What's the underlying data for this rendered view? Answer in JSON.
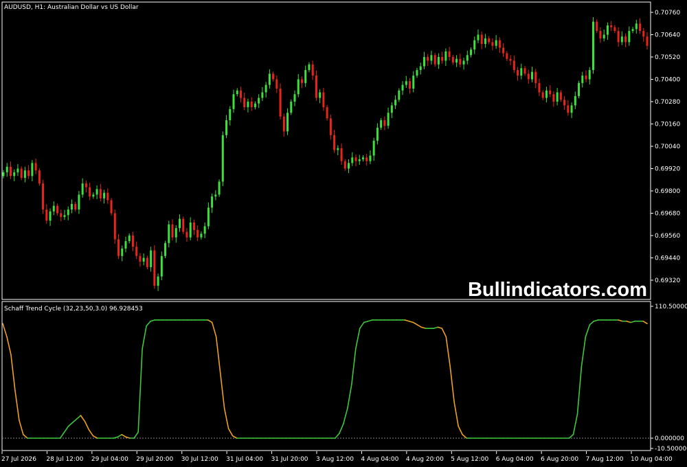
{
  "main_chart": {
    "symbol_label": "AUDUSD, H1:  Australian Dollar vs US Dollar",
    "price_ticks": [
      "0.70760",
      "0.70640",
      "0.70520",
      "0.70400",
      "0.70280",
      "0.70160",
      "0.70040",
      "0.69920",
      "0.69800",
      "0.69680",
      "0.69560",
      "0.69440",
      "0.69320"
    ],
    "watermark": "Bullindicators.com",
    "colors": {
      "bull": "#3ee03e",
      "bear": "#e8251b",
      "background": "#000000",
      "frame": "#ffffff"
    }
  },
  "indicator": {
    "label": "Schaff Trend Cycle (32,23,50,3.0) 96.928453",
    "max_label": "110.500000",
    "zero_label": "0.000000",
    "min_label": "-10.500000",
    "colors": {
      "rising": "#3ec83e",
      "falling": "#f0a020"
    }
  },
  "time_axis": {
    "labels": [
      "27 Jul 2026",
      "28 Jul 12:00",
      "29 Jul 04:00",
      "29 Jul 20:00",
      "30 Jul 12:00",
      "31 Jul 04:00",
      "31 Jul 20:00",
      "3 Aug 12:00",
      "4 Aug 04:00",
      "4 Aug 20:00",
      "5 Aug 12:00",
      "6 Aug 04:00",
      "6 Aug 20:00",
      "7 Aug 12:00",
      "10 Aug 04:00"
    ]
  },
  "chart_data": [
    {
      "type": "candlestick",
      "title": "AUDUSD, H1:  Australian Dollar vs US Dollar",
      "ylim": [
        0.6925,
        0.7083
      ],
      "close_path": [
        0.699,
        0.6993,
        0.6988,
        0.699,
        0.6992,
        0.6987,
        0.6991,
        0.6988,
        0.6995,
        0.6991,
        0.6984,
        0.697,
        0.6964,
        0.6969,
        0.6972,
        0.6968,
        0.6966,
        0.6967,
        0.697,
        0.6973,
        0.697,
        0.6978,
        0.6984,
        0.6982,
        0.6977,
        0.6978,
        0.6981,
        0.6976,
        0.6979,
        0.6975,
        0.6968,
        0.6954,
        0.6945,
        0.6949,
        0.6953,
        0.6956,
        0.695,
        0.6945,
        0.6942,
        0.6944,
        0.6939,
        0.6948,
        0.6929,
        0.6934,
        0.6945,
        0.6952,
        0.6962,
        0.6955,
        0.696,
        0.6965,
        0.6958,
        0.6955,
        0.6963,
        0.6959,
        0.6955,
        0.6957,
        0.6961,
        0.6971,
        0.6977,
        0.6978,
        0.6985,
        0.701,
        0.7018,
        0.7024,
        0.7032,
        0.7034,
        0.703,
        0.7025,
        0.7028,
        0.7025,
        0.7027,
        0.703,
        0.7033,
        0.7037,
        0.7043,
        0.704,
        0.7035,
        0.702,
        0.7012,
        0.7022,
        0.7028,
        0.7032,
        0.704,
        0.7038,
        0.7045,
        0.7048,
        0.7042,
        0.703,
        0.7033,
        0.7025,
        0.7019,
        0.701,
        0.7002,
        0.7003,
        0.6996,
        0.6992,
        0.6995,
        0.6998,
        0.6996,
        0.6997,
        0.6998,
        0.6996,
        0.6999,
        0.7007,
        0.7014,
        0.7018,
        0.7015,
        0.7022,
        0.7026,
        0.7029,
        0.7034,
        0.7037,
        0.7039,
        0.7035,
        0.7042,
        0.7045,
        0.7047,
        0.7052,
        0.705,
        0.7053,
        0.7048,
        0.7052,
        0.705,
        0.7055,
        0.7052,
        0.7049,
        0.7051,
        0.7048,
        0.705,
        0.7053,
        0.7056,
        0.7061,
        0.7064,
        0.7059,
        0.7062,
        0.706,
        0.7058,
        0.7061,
        0.7057,
        0.7054,
        0.7051,
        0.705,
        0.7045,
        0.7042,
        0.7046,
        0.7043,
        0.704,
        0.7044,
        0.7038,
        0.7033,
        0.703,
        0.7034,
        0.7032,
        0.7028,
        0.7033,
        0.7029,
        0.7026,
        0.7022,
        0.7026,
        0.7031,
        0.7038,
        0.7042,
        0.704,
        0.7045,
        0.7071,
        0.7066,
        0.7062,
        0.7064,
        0.7069,
        0.7068,
        0.7066,
        0.706,
        0.7063,
        0.706,
        0.7066,
        0.7067,
        0.707,
        0.7066,
        0.7063,
        0.7058
      ]
    },
    {
      "type": "line",
      "title": "Schaff Trend Cycle (32,23,50,3.0) 96.928453",
      "ylim": [
        -10.5,
        110.5
      ],
      "series": [
        {
          "values": [
            96,
            85,
            70,
            40,
            15,
            3,
            0,
            0,
            0,
            0,
            0,
            0,
            0,
            0,
            0,
            5,
            10,
            13,
            16,
            19,
            14,
            7,
            2,
            0,
            0,
            0,
            0,
            0,
            1,
            3,
            1,
            0,
            0,
            5,
            75,
            94,
            98,
            99,
            99,
            99,
            99,
            99,
            99,
            99,
            99,
            99,
            99,
            99,
            99,
            99,
            99,
            97,
            85,
            55,
            25,
            8,
            2,
            0,
            0,
            0,
            0,
            0,
            0,
            0,
            0,
            0,
            0,
            0,
            0,
            0,
            0,
            0,
            0,
            0,
            0,
            0,
            0,
            0,
            0,
            0,
            0,
            0,
            4,
            12,
            25,
            45,
            75,
            92,
            97,
            98,
            99,
            99,
            99,
            99,
            99,
            99,
            99,
            99,
            99,
            98,
            97,
            95,
            93,
            92,
            92,
            92,
            93,
            92,
            85,
            60,
            30,
            10,
            3,
            0,
            0,
            0,
            0,
            0,
            0,
            0,
            0,
            0,
            0,
            0,
            0,
            0,
            0,
            0,
            0,
            0,
            0,
            0,
            0,
            0,
            0,
            0,
            0,
            0,
            0,
            3,
            20,
            60,
            85,
            95,
            98,
            99,
            99,
            99,
            99,
            99,
            99,
            98,
            98,
            97,
            98,
            98,
            98,
            96
          ]
        }
      ]
    }
  ]
}
